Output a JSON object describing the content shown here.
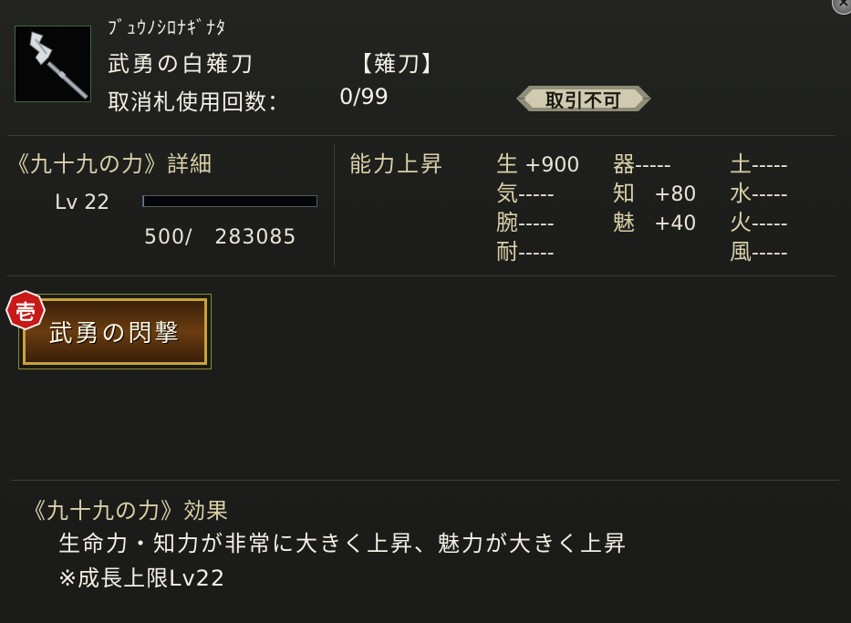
{
  "item": {
    "furigana": "ﾌﾞｭｳﾉｼﾛﾅｷﾞﾅﾀ",
    "name": "武勇の白薙刀",
    "category": "【薙刀】",
    "usage_label": "取消札使用回数：",
    "usage_value": "0/99",
    "trade_status": "取引不可",
    "icon": "naginata-icon"
  },
  "details": {
    "title": "《九十九の力》詳細",
    "level": "Lv 22",
    "exp_progress": 0.0018,
    "exp_text": "500/   283085"
  },
  "ability": {
    "title": "能力上昇",
    "stats": [
      {
        "key": "生",
        "val": " +900"
      },
      {
        "key": "気",
        "val": "-----"
      },
      {
        "key": "腕",
        "val": "-----"
      },
      {
        "key": "耐",
        "val": "-----"
      },
      {
        "key": "器",
        "val": "-----"
      },
      {
        "key": "知",
        "val": "   +80"
      },
      {
        "key": "魅",
        "val": "   +40"
      },
      {
        "key": "土",
        "val": "-----"
      },
      {
        "key": "水",
        "val": "-----"
      },
      {
        "key": "火",
        "val": "-----"
      },
      {
        "key": "風",
        "val": "-----"
      }
    ]
  },
  "skill": {
    "rank": "壱",
    "name": "武勇の閃撃"
  },
  "effect": {
    "title": "《九十九の力》効果",
    "line1": "生命力・知力が非常に大きく上昇、魅力が大きく上昇",
    "line2": "※成長上限Lv22"
  },
  "colors": {
    "label_gold": "#d9cfa8",
    "text": "#f3f0e6",
    "background": "#1d1e1b"
  }
}
